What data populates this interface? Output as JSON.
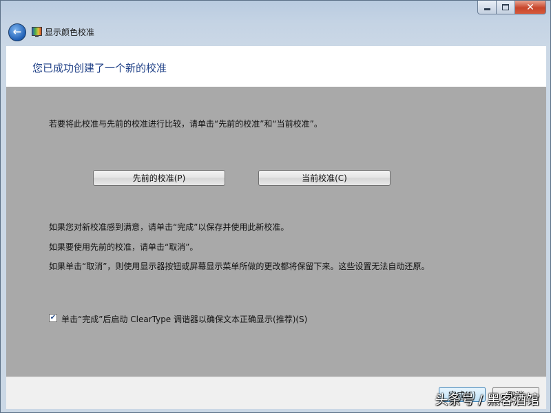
{
  "window": {
    "title": "显示颜色校准",
    "controls": {
      "minimize_icon": "minimize-icon",
      "maximize_icon": "maximize-icon",
      "close_glyph": "✕"
    }
  },
  "header": {
    "title": "您已成功创建了一个新的校准"
  },
  "main": {
    "intro": "若要将此校准与先前的校准进行比较，请单击“先前的校准”和“当前校准”。",
    "buttons": {
      "previous": "先前的校准(P)",
      "current": "当前校准(C)"
    },
    "paragraphs": [
      "如果您对新校准感到满意，请单击“完成”以保存并使用此新校准。",
      "如果要使用先前的校准，请单击“取消”。",
      "如果单击“取消”，则使用显示器按钮或屏幕显示菜单所做的更改都将保留下来。这些设置无法自动还原。"
    ],
    "cleartype_checkbox": {
      "label": "单击“完成”后启动 ClearType 调谐器以确保文本正确显示(推荐)(S)",
      "checked": true
    }
  },
  "footer": {
    "finish": "完成(F)",
    "cancel": "取消"
  },
  "watermark": "头条号 / 黑客酒馆",
  "colors": {
    "header_title": "#1e3f86",
    "content_bg": "#a9a9a9",
    "close_button": "#c7452b"
  }
}
